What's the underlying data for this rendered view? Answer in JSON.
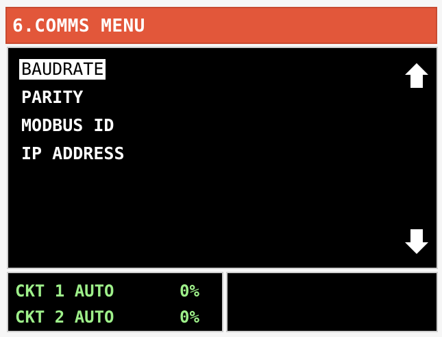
{
  "header": {
    "title": "6.COMMS MENU"
  },
  "menu": {
    "items": [
      {
        "label": "BAUDRATE",
        "selected": true
      },
      {
        "label": "PARITY",
        "selected": false
      },
      {
        "label": "MODBUS ID",
        "selected": false
      },
      {
        "label": "IP ADDRESS",
        "selected": false
      }
    ],
    "scroll_up_icon": "arrow-up-icon",
    "scroll_down_icon": "arrow-down-icon"
  },
  "status": {
    "circuits": [
      {
        "label": "CKT 1 AUTO",
        "value": "0%"
      },
      {
        "label": "CKT 2 AUTO",
        "value": "0%"
      }
    ]
  },
  "colors": {
    "title_bar": "#e2573a",
    "panel_bg": "#000000",
    "menu_text": "#ffffff",
    "status_text": "#9ef08a"
  }
}
